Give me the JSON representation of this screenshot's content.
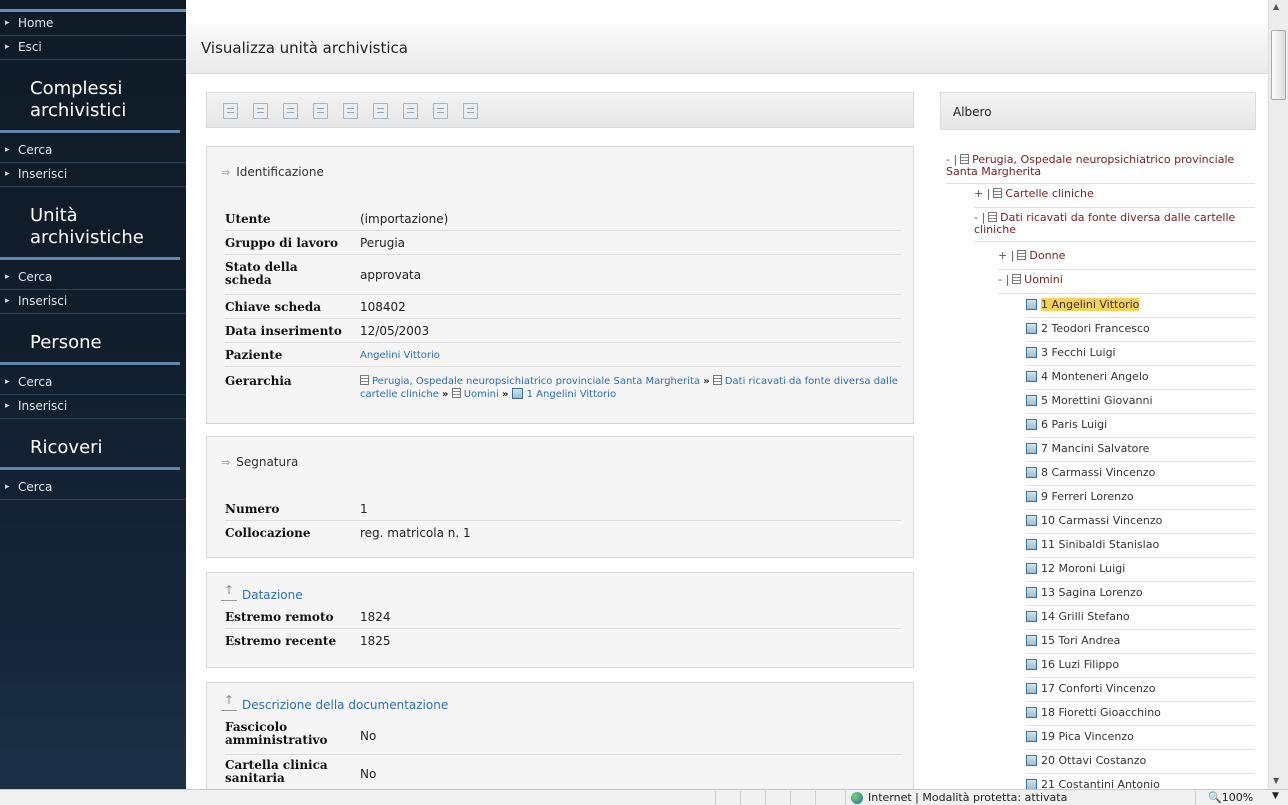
{
  "sidebar": {
    "top_links": [
      "Home",
      "Esci"
    ],
    "sections": [
      {
        "title": "Complessi archivistici",
        "links": [
          "Cerca",
          "Inserisci"
        ]
      },
      {
        "title": "Unità archivistiche",
        "links": [
          "Cerca",
          "Inserisci"
        ]
      },
      {
        "title": "Persone",
        "links": [
          "Cerca",
          "Inserisci"
        ]
      },
      {
        "title": "Ricoveri",
        "links": [
          "Cerca"
        ]
      }
    ]
  },
  "page": {
    "title": "Visualizza unità archivistica"
  },
  "identificazione": {
    "title": "Identificazione",
    "utente_label": "Utente",
    "utente": "(importazione)",
    "gruppo_label": "Gruppo di lavoro",
    "gruppo": "Perugia",
    "stato_label": "Stato della scheda",
    "stato": "approvata",
    "chiave_label": "Chiave scheda",
    "chiave": "108402",
    "data_label": "Data inserimento",
    "data": "12/05/2003",
    "paziente_label": "Paziente",
    "paziente": "Angelini Vittorio",
    "gerarchia_label": "Gerarchia",
    "gerarchia": [
      "Perugia, Ospedale neuropsichiatrico provinciale Santa Margherita",
      "Dati ricavati da fonte diversa dalle cartelle cliniche",
      "Uomini",
      "1 Angelini Vittorio"
    ],
    "sep": "»"
  },
  "segnatura": {
    "title": "Segnatura",
    "numero_label": "Numero",
    "numero": "1",
    "collocazione_label": "Collocazione",
    "collocazione": "reg. matricola n. 1"
  },
  "datazione": {
    "title": "Datazione",
    "remoto_label": "Estremo remoto",
    "remoto": "1824",
    "recente_label": "Estremo recente",
    "recente": "1825"
  },
  "descrizione": {
    "title": "Descrizione della documentazione",
    "fascicolo_label": "Fascicolo amministrativo",
    "fascicolo": "No",
    "cartella_label": "Cartella clinica sanitaria",
    "cartella": "No"
  },
  "albero": {
    "title": "Albero",
    "nodes": [
      {
        "pm": "- |",
        "label": "Perugia, Ospedale neuropsichiatrico provinciale Santa Margherita"
      },
      {
        "pm": "+ |",
        "label": "Cartelle cliniche"
      },
      {
        "pm": "- |",
        "label": "Dati ricavati da fonte diversa dalle cartelle cliniche"
      },
      {
        "pm": "+ |",
        "label": "Donne"
      },
      {
        "pm": "- |",
        "label": "Uomini"
      }
    ],
    "leaves": [
      "1 Angelini Vittorio",
      "2 Teodori Francesco",
      "3 Fecchi Luigi",
      "4 Monteneri Angelo",
      "5 Morettini Giovanni",
      "6 Paris Luigi",
      "7 Mancini Salvatore",
      "8 Carmassi Vincenzo",
      "9 Ferreri Lorenzo",
      "10 Carmassi Vincenzo",
      "11 Sinibaldi Stanislao",
      "12 Moroni Luigi",
      "13 Sagina Lorenzo",
      "14 Grilli Stefano",
      "15 Tori Andrea",
      "16 Luzi Filippo",
      "17 Conforti Vincenzo",
      "18 Fioretti Gioacchino",
      "19 Pica Vincenzo",
      "20 Ottavi Costanzo",
      "21 Costantini Antonio"
    ],
    "selected_index": 0
  },
  "statusbar": {
    "zone": "Internet | Modalità protetta: attivata",
    "zoom": "100%"
  },
  "colors": {
    "sidebar_bg": "#0f1b27",
    "link_blue": "#2b6eb5",
    "tree_red": "#7a2020",
    "highlight": "#f8d15a"
  }
}
